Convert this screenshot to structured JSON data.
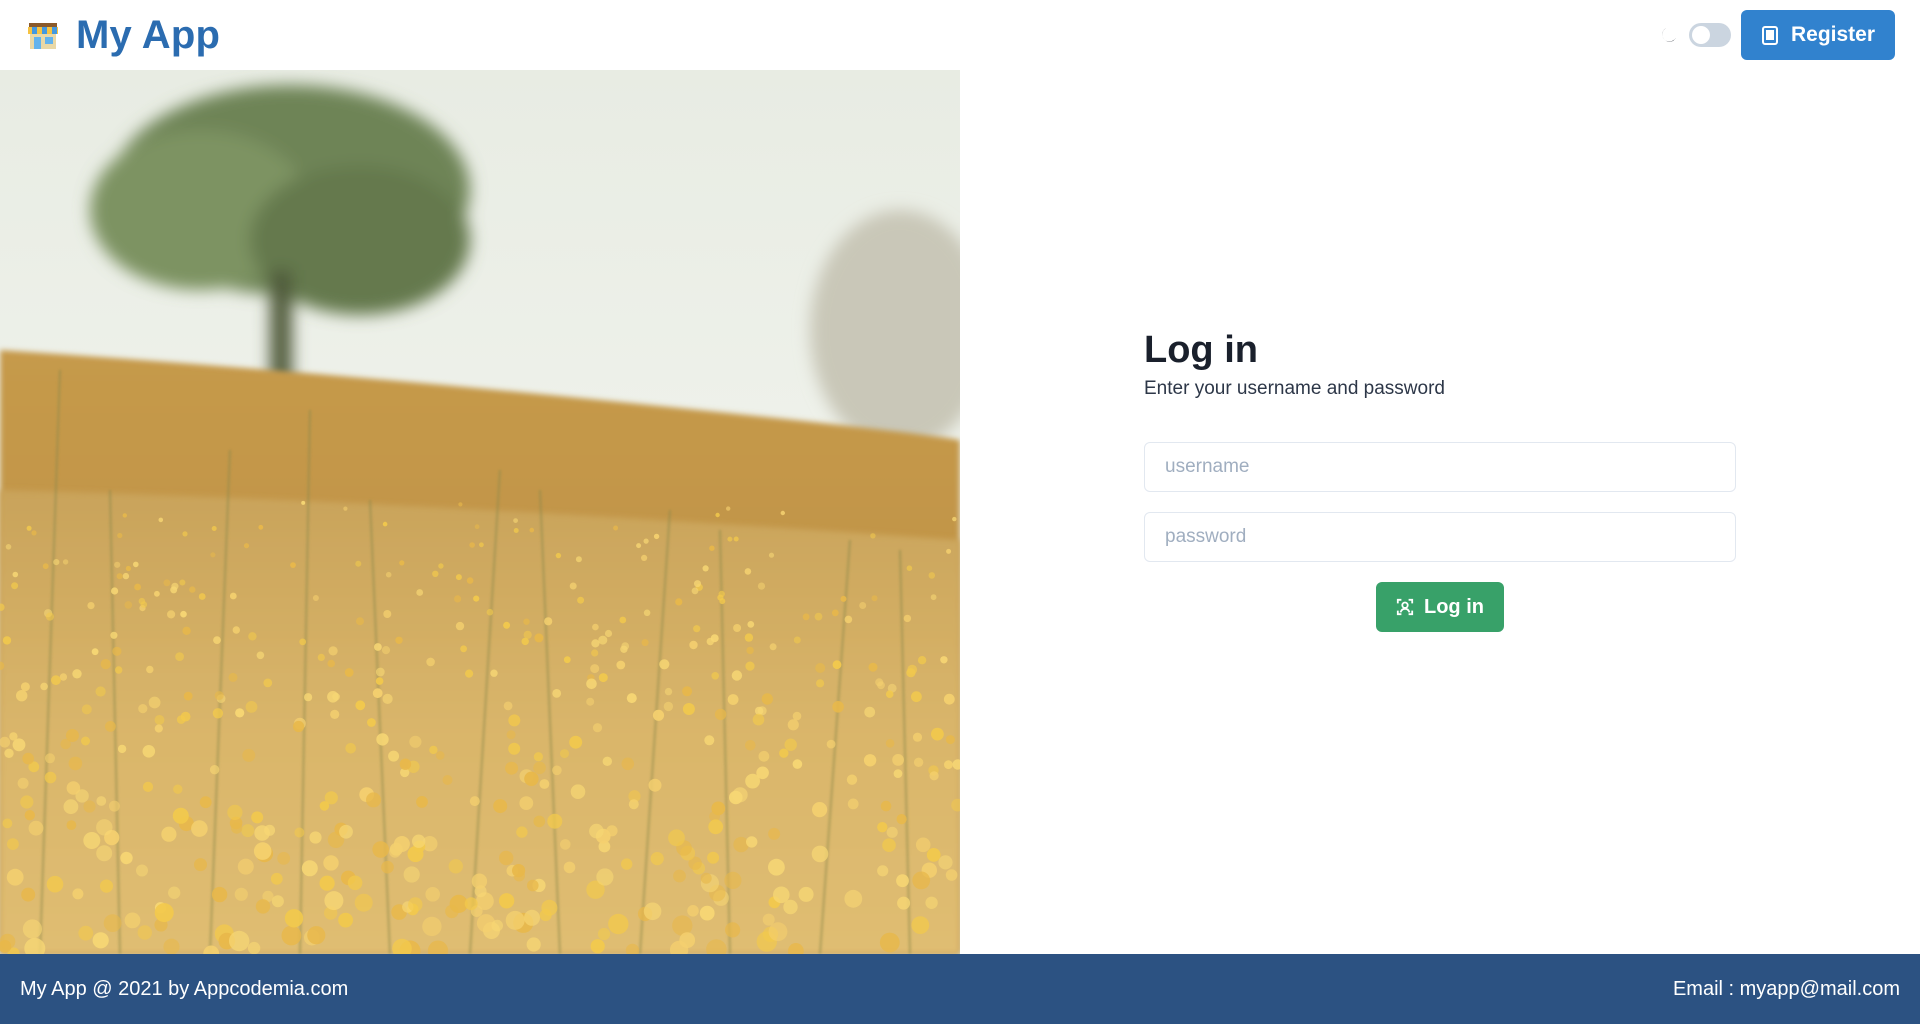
{
  "header": {
    "brand_title": "My App",
    "brand_icon": "store-icon",
    "theme_icon": "moon-icon",
    "register_label": "Register"
  },
  "hero": {
    "image": "flower-field-photo"
  },
  "login": {
    "title": "Log in",
    "subtitle": "Enter your username and password",
    "username_placeholder": "username",
    "password_placeholder": "password",
    "submit_label": "Log in"
  },
  "footer": {
    "left_text": "My App @ 2021 by Appcodemia.com",
    "right_text": "Email : myapp@mail.com"
  },
  "colors": {
    "brand": "#2b6cb0",
    "register_button": "#3182ce",
    "login_button": "#38a169",
    "footer": "#2c5282"
  }
}
